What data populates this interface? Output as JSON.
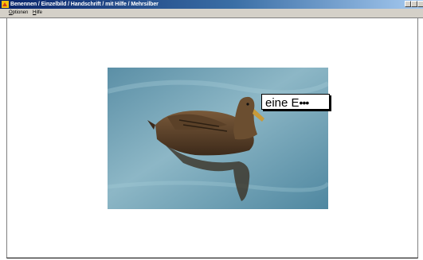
{
  "window": {
    "title": "Benennen / Einzelbild / Handschrift / mit Hilfe / Mehrsilber"
  },
  "menu": {
    "items": [
      {
        "label_first": "O",
        "label_rest": "ptionen"
      },
      {
        "label_first": "H",
        "label_rest": "ilfe"
      }
    ]
  },
  "answer": {
    "text": "eine E",
    "placeholder": "•••"
  },
  "colors": {
    "titlebar_start": "#0a246a",
    "titlebar_end": "#a6caf0",
    "water": "#6f9fb4"
  }
}
